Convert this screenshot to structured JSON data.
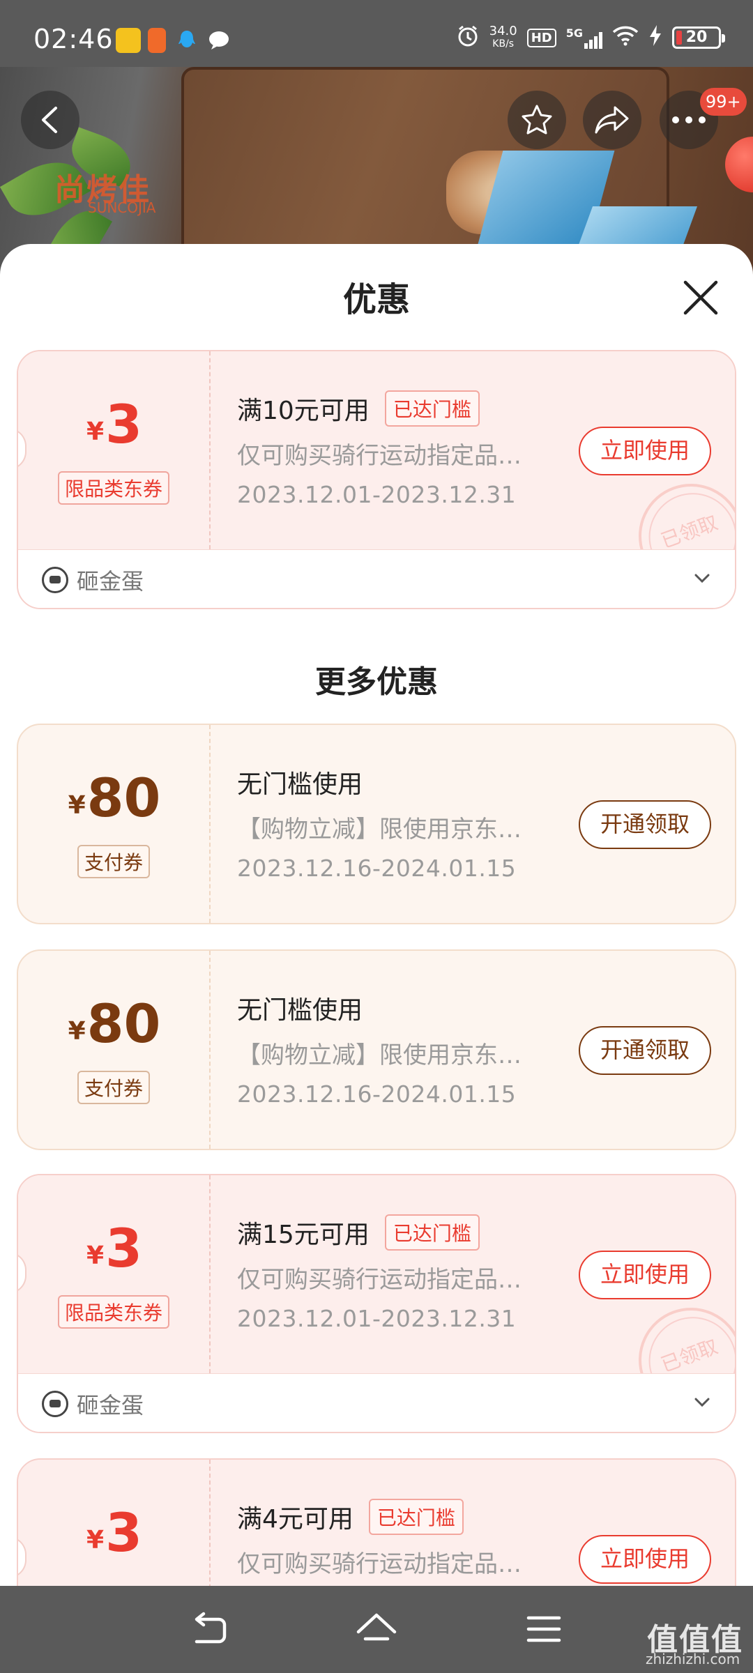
{
  "status_bar": {
    "time": "02:46",
    "net_speed_value": "34.0",
    "net_speed_unit": "KB/s",
    "hd": "HD",
    "network": "5G",
    "battery": "20"
  },
  "banner": {
    "brand": "尚烤佳",
    "brand_sub": "SUNCOJIA",
    "cart_badge": "99+"
  },
  "sheet": {
    "title": "优惠",
    "more_title": "更多优惠"
  },
  "coupons": [
    {
      "currency": "¥",
      "amount": "3",
      "type": "限品类东券",
      "title": "满10元可用",
      "badge": "已达门槛",
      "desc": "仅可购买骑行运动指定品…",
      "date": "2023.12.01-2023.12.31",
      "button": "立即使用",
      "stamp": "已领取",
      "footer": "砸金蛋"
    },
    {
      "currency": "¥",
      "amount": "80",
      "type": "支付券",
      "title": "无门槛使用",
      "desc": "【购物立减】限使用京东…",
      "date": "2023.12.16-2024.01.15",
      "button": "开通领取"
    },
    {
      "currency": "¥",
      "amount": "80",
      "type": "支付券",
      "title": "无门槛使用",
      "desc": "【购物立减】限使用京东…",
      "date": "2023.12.16-2024.01.15",
      "button": "开通领取"
    },
    {
      "currency": "¥",
      "amount": "3",
      "type": "限品类东券",
      "title": "满15元可用",
      "badge": "已达门槛",
      "desc": "仅可购买骑行运动指定品…",
      "date": "2023.12.01-2023.12.31",
      "button": "立即使用",
      "stamp": "已领取",
      "footer": "砸金蛋"
    },
    {
      "currency": "¥",
      "amount": "3",
      "type": "限品类东券",
      "title": "满4元可用",
      "badge": "已达门槛",
      "desc": "仅可购买骑行运动指定品…",
      "button": "立即使用"
    }
  ],
  "watermark": {
    "text": "值值值",
    "sub": "zhizhizhi.com"
  },
  "colors": {
    "accent_red": "#e93b2f",
    "accent_brown": "#7a3a10",
    "coupon_red_bg": "#fdeeec",
    "coupon_peach_bg": "#fdf5ef"
  }
}
